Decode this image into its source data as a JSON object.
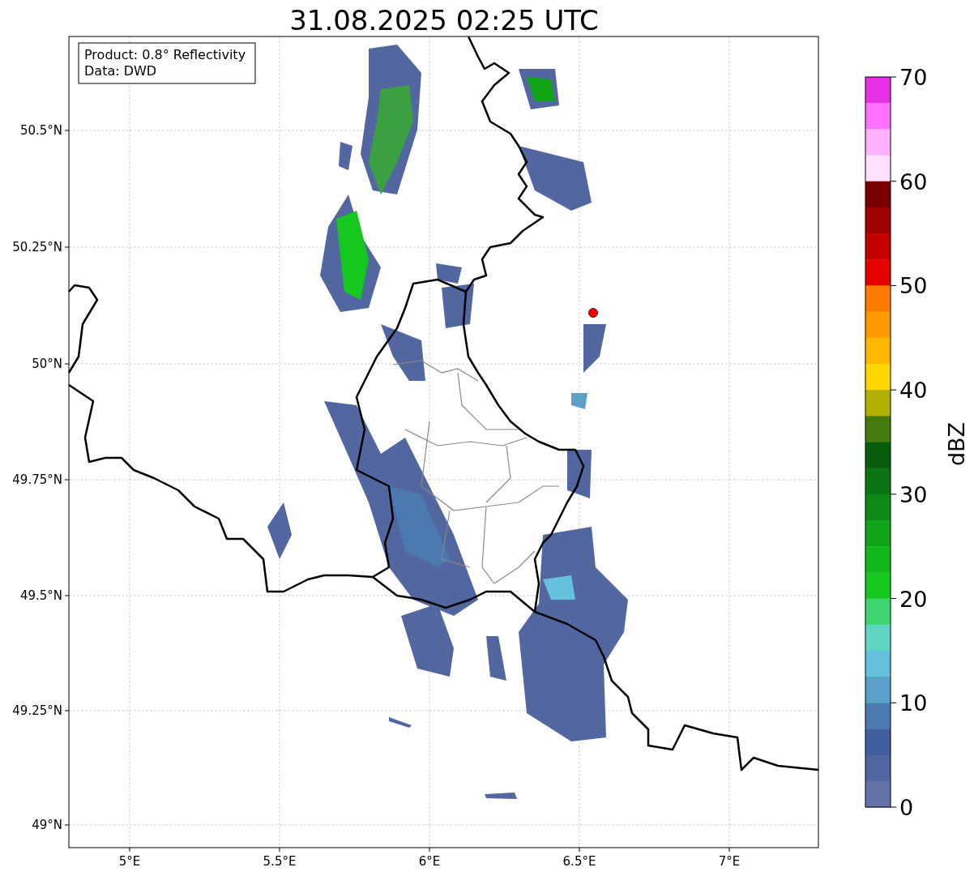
{
  "title": "31.08.2025 02:25 UTC",
  "info_box": {
    "product": "Product: 0.8° Reflectivity",
    "data": "Data: DWD"
  },
  "map": {
    "yticks": [
      "50.5°N",
      "50.25°N",
      "50°N",
      "49.75°N",
      "49.5°N",
      "49.25°N",
      "49°N"
    ],
    "xticks": [
      "5°E",
      "5.5°E",
      "6°E",
      "6.5°E",
      "7°E"
    ]
  },
  "colorbar": {
    "label": "dBZ",
    "ticks": [
      "70",
      "60",
      "50",
      "40",
      "30",
      "20",
      "10",
      "0"
    ],
    "bins": [
      {
        "color": "#e830e8"
      },
      {
        "color": "#ff70ff"
      },
      {
        "color": "#ffb0ff"
      },
      {
        "color": "#ffe0ff"
      },
      {
        "color": "#7a0000"
      },
      {
        "color": "#a00000"
      },
      {
        "color": "#c40000"
      },
      {
        "color": "#e60000"
      },
      {
        "color": "#ff7b00"
      },
      {
        "color": "#ff9900"
      },
      {
        "color": "#ffb700"
      },
      {
        "color": "#ffd700"
      },
      {
        "color": "#b0b000"
      },
      {
        "color": "#457a0c"
      },
      {
        "color": "#085c0e"
      },
      {
        "color": "#0a7512"
      },
      {
        "color": "#0d8a16"
      },
      {
        "color": "#0fa516"
      },
      {
        "color": "#10b81a"
      },
      {
        "color": "#14c81e"
      },
      {
        "color": "#3dd672"
      },
      {
        "color": "#5fd6c2"
      },
      {
        "color": "#66c2dc"
      },
      {
        "color": "#5aa0c8"
      },
      {
        "color": "#4a7ab0"
      },
      {
        "color": "#425e9e"
      },
      {
        "color": "#52679f"
      },
      {
        "color": "#6373a8"
      }
    ]
  }
}
